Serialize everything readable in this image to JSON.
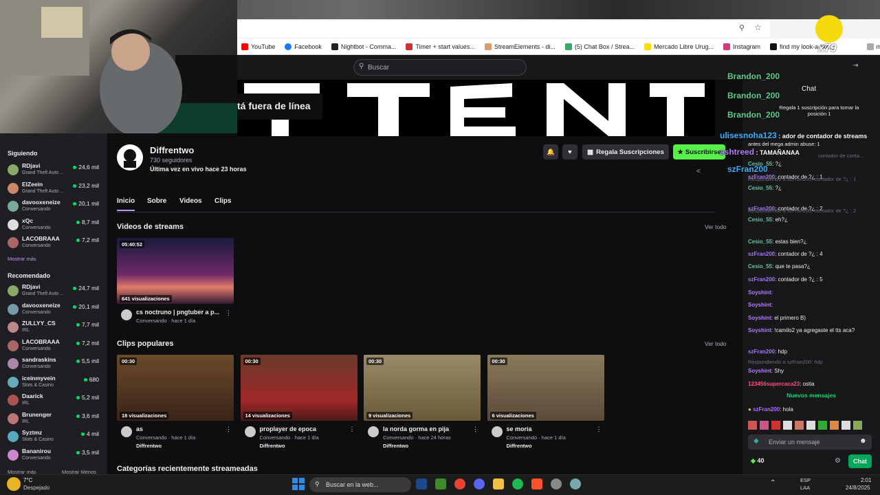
{
  "browser": {
    "bookmarks": [
      "YouTube",
      "Facebook",
      "Nightbot - Comma...",
      "Timer + start values...",
      "StreamElements - di...",
      "(5) Chat Box / Strea...",
      "Mercado Libre Urug...",
      "Instagram",
      "find my look-a-like,..."
    ],
    "bookmarks_more": "marcadores",
    "search_placeholder": "Buscar"
  },
  "overlay": {
    "sticker_count": "x79"
  },
  "sidebar": {
    "following_title": "Siguiendo",
    "following": [
      {
        "name": "RDjavi",
        "sub": "Grand Theft Auto ...",
        "count": "24,6 mil"
      },
      {
        "name": "ElZeein",
        "sub": "Grand Theft Auto ...",
        "count": "23,2 mil"
      },
      {
        "name": "davooxeneize",
        "sub": "Conversando",
        "count": "20,1 mil"
      },
      {
        "name": "xQc",
        "sub": "Conversando",
        "count": "8,7 mil"
      },
      {
        "name": "LACOBRAAA",
        "sub": "Conversando",
        "count": "7,2 mil"
      }
    ],
    "show_more": "Mostrar más",
    "recommended_title": "Recomendado",
    "recommended": [
      {
        "name": "RDjavi",
        "sub": "Grand Theft Auto ...",
        "count": "24,7 mil"
      },
      {
        "name": "davooxeneize",
        "sub": "Conversando",
        "count": "20,1 mil"
      },
      {
        "name": "ZULLYY_CS",
        "sub": "IRL",
        "count": "7,7 mil"
      },
      {
        "name": "LACOBRAAA",
        "sub": "Conversando",
        "count": "7,2 mil"
      },
      {
        "name": "sandraskins",
        "sub": "Conversando",
        "count": "5,5 mil"
      },
      {
        "name": "iceinmyvein",
        "sub": "Slots & Casino",
        "count": "680"
      },
      {
        "name": "Daarick",
        "sub": "IRL",
        "count": "5,2 mil"
      },
      {
        "name": "Brunenger",
        "sub": "IRL",
        "count": "3,6 mil"
      },
      {
        "name": "Syztmz",
        "sub": "Slots & Casino",
        "count": "4 mil"
      },
      {
        "name": "Bananirou",
        "sub": "Conversando",
        "count": "3,5 mil"
      }
    ],
    "show_more2": "Mostrar más",
    "show_less": "Mostrar Menos"
  },
  "channel": {
    "offline_text": "tá fuera de línea",
    "name": "Diffrentwo",
    "followers": "730 seguidores",
    "last_live": "Última vez en vivo hace 23 horas",
    "gift_label": "Regala Suscripciones",
    "subscribe_label": "Suscribirse",
    "tabs": [
      "Inicio",
      "Sobre",
      "Videos",
      "Clips"
    ]
  },
  "streams_section": {
    "title": "Videos de streams",
    "see_all": "Ver todo",
    "video": {
      "duration": "05:40:52",
      "views": "641 visualizaciones",
      "title": "cs noctruno | pngtuber a p...",
      "meta": "Conversando · hace 1 día"
    }
  },
  "clips_section": {
    "title": "Clips populares",
    "see_all": "Ver todo",
    "clips": [
      {
        "duration": "00:30",
        "views": "18 visualizaciones",
        "title": "as",
        "meta": "Conversando · hace 1 día",
        "channel": "Diffrentwo"
      },
      {
        "duration": "00:30",
        "views": "14 visualizaciones",
        "title": "proplayer de epoca",
        "meta": "Conversando · hace 1 día",
        "channel": "Diffrentwo"
      },
      {
        "duration": "00:30",
        "views": "9 visualizaciones",
        "title": "la norda gorma en pija",
        "meta": "Conversando · hace 24 horas",
        "channel": "Diffrentwo"
      },
      {
        "duration": "00:30",
        "views": "6 visualizaciones",
        "title": "se moria",
        "meta": "Conversando · hace 1 día",
        "channel": "Diffrentwo"
      }
    ]
  },
  "categories_title": "Categorías recientemente streameadas",
  "chat_overlay": [
    {
      "user": "Brandon_200",
      "text": ""
    },
    {
      "user": "Brandon_200",
      "text": ""
    },
    {
      "user": "Brandon_200",
      "text": ""
    },
    {
      "user": "ulisesnoha123",
      "text": "ador de contador de streams"
    },
    {
      "user": "ashtreed",
      "text": "TAMAÑANAA"
    },
    {
      "user": "szFran200",
      "text": ""
    }
  ],
  "chat": {
    "title": "Chat",
    "gift_notice": "Regala 1 suscripción para tomar la posición 1",
    "pinned_extra": "antes del mega admin abuse: 1",
    "pinned_extra2": "contador de conta...",
    "messages": [
      {
        "user": "Cesio_55",
        "text": "?¿",
        "color": "#5bc8a0",
        "reply": ""
      },
      {
        "user": "szFran200",
        "text": "contador de ?¿ : 1",
        "color": "#a970ff",
        "reply": ""
      },
      {
        "user": "Cesio_55",
        "text": "?¿",
        "color": "#5bc8a0",
        "reply": "Respondiendo a szFran200: contador de ?¿ : 1"
      },
      {
        "user": "szFran200",
        "text": "contador de ?¿ : 2",
        "color": "#a970ff",
        "reply": ""
      },
      {
        "user": "Cesio_55",
        "text": "eh?¿",
        "color": "#5bc8a0",
        "reply": "Respondiendo a szFran200: contador de ?¿ : 2"
      },
      {
        "user": "Cesio_55",
        "text": "estas bien?¿",
        "color": "#5bc8a0",
        "reply": ""
      },
      {
        "user": "szFran200",
        "text": "contador de ?¿ : 4",
        "color": "#a970ff",
        "reply": ""
      },
      {
        "user": "Cesio_55",
        "text": "que te pasa?¿",
        "color": "#5bc8a0",
        "reply": ""
      },
      {
        "user": "szFran200",
        "text": "contador de ?¿ : 5",
        "color": "#a970ff",
        "reply": ""
      },
      {
        "user": "Soyshint",
        "text": "",
        "color": "#b57bff",
        "reply": ""
      },
      {
        "user": "Soyshint",
        "text": "",
        "color": "#b57bff",
        "reply": ""
      },
      {
        "user": "Soyshint",
        "text": "el primero B)",
        "color": "#b57bff",
        "reply": ""
      },
      {
        "user": "Soyshint",
        "text": "!camilo2 ya agregaste el tts aca?",
        "color": "#b57bff",
        "reply": ""
      },
      {
        "user": "szFran200",
        "text": "hdp",
        "color": "#a970ff",
        "reply": ""
      },
      {
        "user": "Soyshint",
        "text": "Shy",
        "color": "#b57bff",
        "reply": "Respondiendo a szFran200: hdp"
      },
      {
        "user": "123456supercaca23",
        "text": "ostia",
        "color": "#ff4f7b",
        "reply": ""
      }
    ],
    "new_messages": "Nuevos mensajes",
    "last": {
      "user": "szFran200",
      "text": "hola"
    },
    "input_placeholder": "Enviar un mensaje",
    "points": "40",
    "send_label": "Chat"
  },
  "taskbar": {
    "temp": "7°C",
    "weather": "Despejado",
    "search": "Buscar en la web...",
    "lang1": "ESP",
    "lang2": "LAA",
    "time": "2:01",
    "date": "24/8/2025"
  }
}
